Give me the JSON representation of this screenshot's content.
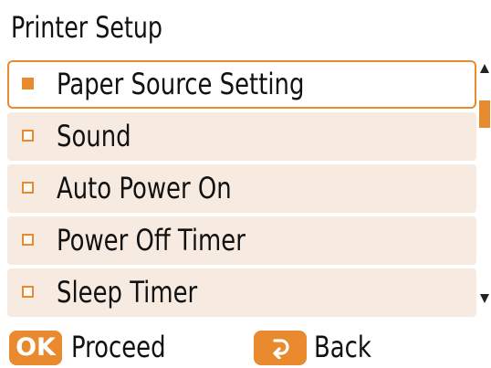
{
  "header": {
    "title": "Printer Setup"
  },
  "menu": {
    "items": [
      {
        "label": "Paper Source Setting",
        "selected": true
      },
      {
        "label": "Sound",
        "selected": false
      },
      {
        "label": "Auto Power On",
        "selected": false
      },
      {
        "label": "Power Off Timer",
        "selected": false
      },
      {
        "label": "Sleep Timer",
        "selected": false
      }
    ]
  },
  "footer": {
    "ok_badge": "OK",
    "proceed_label": "Proceed",
    "back_icon": "back-arrow-icon",
    "back_label": "Back"
  },
  "colors": {
    "accent": "#e98a2e",
    "item_background": "#f7ebe1",
    "text": "#111111",
    "background": "#ffffff"
  }
}
